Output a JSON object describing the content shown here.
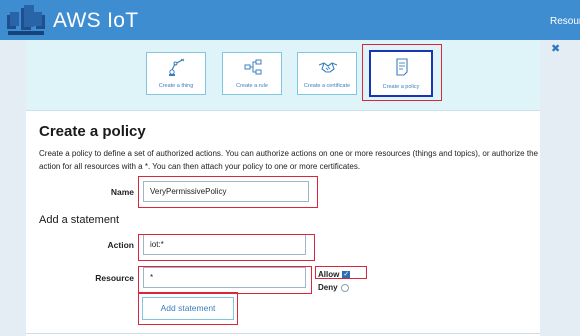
{
  "header": {
    "app_title": "AWS IoT",
    "top_right": "Resour"
  },
  "quick_actions": [
    {
      "label": "Create a thing",
      "icon": "robot-arm-icon"
    },
    {
      "label": "Create a rule",
      "icon": "rule-flow-icon"
    },
    {
      "label": "Create a certificate",
      "icon": "handshake-icon"
    },
    {
      "label": "Create a policy",
      "icon": "policy-document-icon",
      "selected": true
    }
  ],
  "form": {
    "title": "Create a policy",
    "description": "Create a policy to define a set of authorized actions. You can authorize actions on one or more resources (things and topics), or authorize the action for all resources with a *. You can then attach your policy to one or more certificates.",
    "name_label": "Name",
    "name_value": "VeryPermissivePolicy",
    "statement_heading": "Add a statement",
    "action_label": "Action",
    "action_value": "iot:*",
    "resource_label": "Resource",
    "resource_value": "*",
    "allow_label": "Allow",
    "allow_checked": true,
    "deny_label": "Deny",
    "deny_checked": false,
    "add_statement_label": "Add statement"
  },
  "colors": {
    "header_bg": "#3f8dd1",
    "accent": "#3c7fbf",
    "highlight": "#d9263d",
    "selected_border": "#1a35b3"
  }
}
